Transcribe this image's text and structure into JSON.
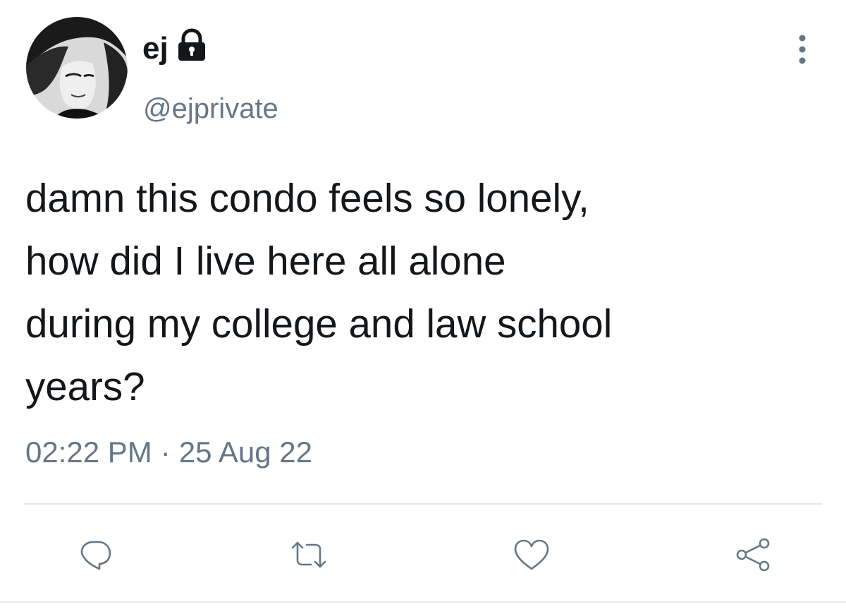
{
  "tweet": {
    "author": {
      "display_name": "ej",
      "handle": "@ejprivate",
      "protected_icon": "lock-icon",
      "avatar": "profile-avatar"
    },
    "text": "damn this condo feels so lonely,\nhow did I live here all alone\nduring my college and law school\nyears?",
    "time": "02:22 PM",
    "separator": "·",
    "date": "25 Aug 22",
    "menu_icon": "more-vertical-icon"
  },
  "actions": [
    {
      "name": "reply",
      "icon": "reply-icon"
    },
    {
      "name": "retweet",
      "icon": "retweet-icon"
    },
    {
      "name": "like",
      "icon": "heart-icon"
    },
    {
      "name": "share",
      "icon": "share-icon"
    }
  ],
  "colors": {
    "text_primary": "#14171a",
    "text_secondary": "#657786",
    "divider": "#e1e8ed",
    "background": "#ffffff"
  }
}
